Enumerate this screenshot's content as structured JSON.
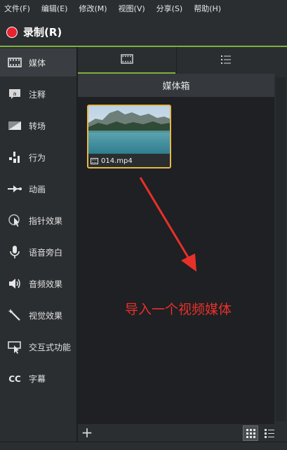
{
  "menu": [
    "文件(F)",
    "编辑(E)",
    "修改(M)",
    "视图(V)",
    "分享(S)",
    "帮助(H)"
  ],
  "record": {
    "label": "录制(R)"
  },
  "sidebar": {
    "items": [
      {
        "label": "媒体",
        "icon": "film-icon"
      },
      {
        "label": "注释",
        "icon": "annotation-icon"
      },
      {
        "label": "转场",
        "icon": "transition-icon"
      },
      {
        "label": "行为",
        "icon": "behavior-icon"
      },
      {
        "label": "动画",
        "icon": "animation-icon"
      },
      {
        "label": "指针效果",
        "icon": "cursor-icon"
      },
      {
        "label": "语音旁白",
        "icon": "microphone-icon"
      },
      {
        "label": "音频效果",
        "icon": "speaker-icon"
      },
      {
        "label": "视觉效果",
        "icon": "magic-wand-icon"
      },
      {
        "label": "交互式功能",
        "icon": "interactive-icon"
      },
      {
        "label": "字幕",
        "icon": "captions-icon"
      }
    ]
  },
  "media_bin": {
    "title": "媒体箱",
    "clips": [
      {
        "name": "014.mp4"
      }
    ]
  },
  "annotation": "导入一个视频媒体",
  "bottom": {
    "add": "+"
  },
  "colors": {
    "accent": "#7fb03a",
    "record": "#e8232f",
    "selection": "#e5b84b",
    "annotation": "#e8302a"
  }
}
